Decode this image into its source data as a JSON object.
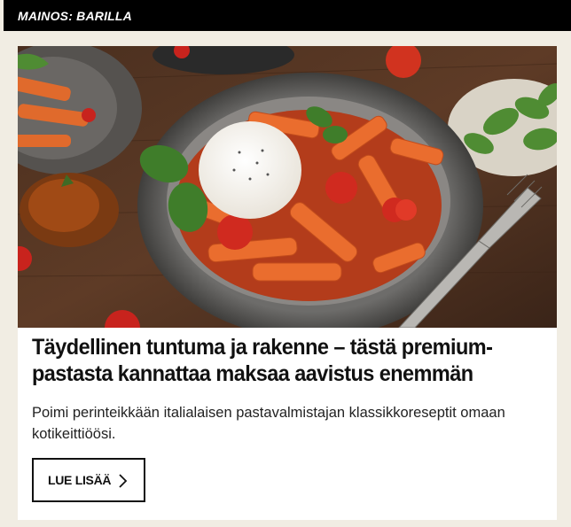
{
  "sponsor_label": "MAINOS: BARILLA",
  "article": {
    "headline": "Täydellinen tuntuma ja rakenne – tästä premium-pastasta kannattaa maksaa aavistus enemmän",
    "body": "Poimi perinteikkään italialaisen pastavalmistajan klassikkoreseptit omaan kotikeittiöösi.",
    "cta_label": "LUE LISÄÄ",
    "cta_icon": "chevron-right-icon"
  },
  "image": {
    "subject": "pasta-with-burrata-photo"
  },
  "colors": {
    "topbar": "#000000",
    "page_bg": "#f1ede3",
    "card_bg": "#ffffff"
  }
}
